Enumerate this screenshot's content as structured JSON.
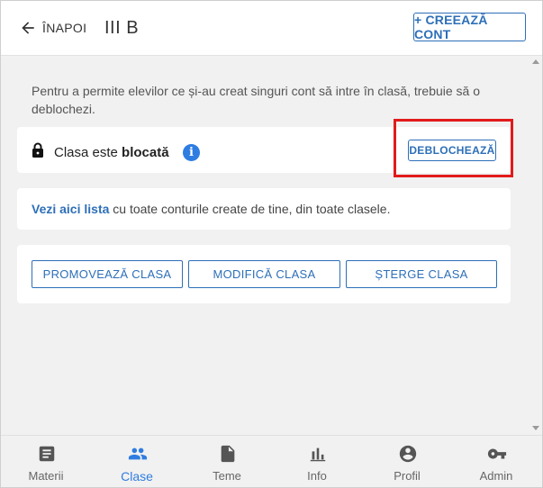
{
  "header": {
    "back_label": "ÎNAPOI",
    "class_title": "III B",
    "create_account_label": "+ CREEAZĂ CONT"
  },
  "info_text": "Pentru a permite elevilor ce și-au creat singuri cont să intre în clasă, trebuie să o deblochezi.",
  "lock_card": {
    "prefix": "Clasa este ",
    "status": "blocată",
    "info_icon": "i",
    "unlock_label": "DEBLOCHEAZĂ"
  },
  "list_card": {
    "link_text": "Vezi aici lista",
    "rest_text": " cu toate conturile create de tine, din toate clasele."
  },
  "actions": {
    "promote_label": "PROMOVEAZĂ CLASA",
    "modify_label": "MODIFICĂ CLASA",
    "delete_label": "ȘTERGE CLASA"
  },
  "bottom_nav": {
    "items": [
      {
        "label": "Materii",
        "icon": "article-icon"
      },
      {
        "label": "Clase",
        "icon": "people-icon",
        "active": true
      },
      {
        "label": "Teme",
        "icon": "file-icon"
      },
      {
        "label": "Info",
        "icon": "bar-chart-icon"
      },
      {
        "label": "Profil",
        "icon": "account-circle-icon"
      },
      {
        "label": "Admin",
        "icon": "key-icon"
      }
    ]
  },
  "colors": {
    "accent": "#2d6fb8",
    "active_nav": "#2f7de1",
    "highlight": "#e21b1b"
  }
}
